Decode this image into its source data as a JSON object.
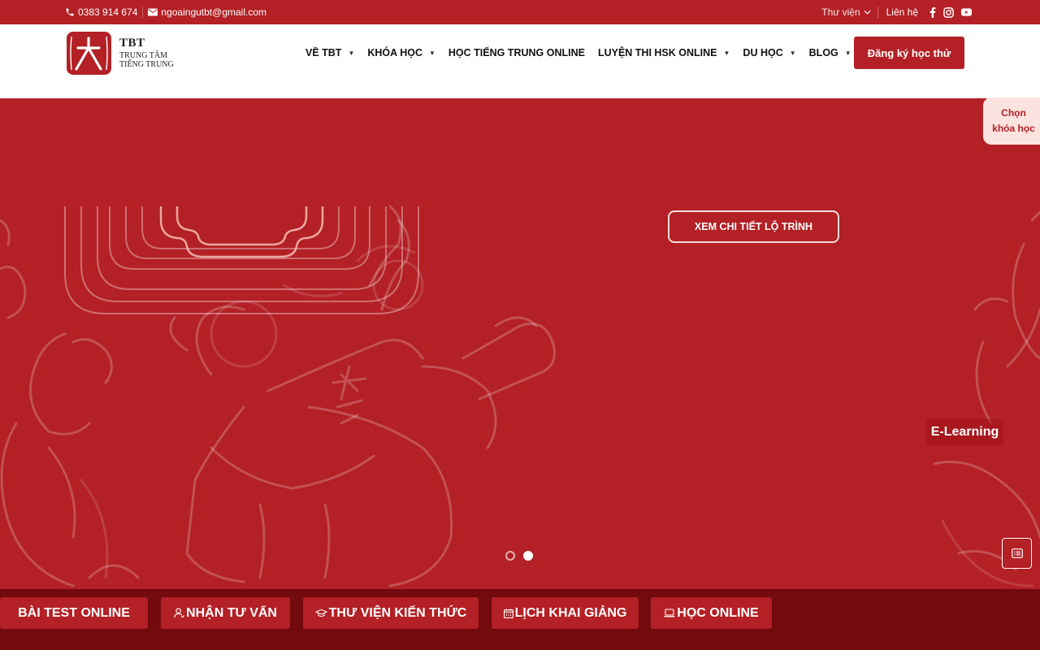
{
  "topbar": {
    "phone": "0383 914 674",
    "email": "ngoaingutbt@gmail.com",
    "library_label": "Thư viện",
    "contact_label": "Liên hệ",
    "social": [
      "facebook-icon",
      "instagram-icon",
      "youtube-icon"
    ]
  },
  "header": {
    "logo": {
      "line1": "TBT",
      "line2": "TRUNG TÂM",
      "line3": "TIẾNG TRUNG"
    },
    "nav": [
      {
        "label": "VỀ TBT",
        "dropdown": true
      },
      {
        "label": "KHÓA HỌC",
        "dropdown": true
      },
      {
        "label": "HỌC TIẾNG TRUNG ONLINE",
        "dropdown": false
      },
      {
        "label": "LUYỆN THI HSK ONLINE",
        "dropdown": true
      },
      {
        "label": "DU HỌC",
        "dropdown": true
      },
      {
        "label": "BLOG",
        "dropdown": true
      }
    ],
    "cta_label": "Đăng ký học thử"
  },
  "hero": {
    "detail_button": "XEM CHI TIẾT LỘ TRÌNH",
    "elearning_label": "E-Learning",
    "slides": 2,
    "active_slide": 2
  },
  "side_tab": {
    "line1": "Chọn",
    "line2": "khóa học"
  },
  "bottom_bar": [
    {
      "label": "BÀI TEST ONLINE",
      "icon": ""
    },
    {
      "label": "NHẬN TƯ VẤN",
      "icon": "user-icon"
    },
    {
      "label": "THƯ VIỆN KIẾN THỨC",
      "icon": "graduation-cap-icon"
    },
    {
      "label": "LỊCH KHAI GIẢNG",
      "icon": "calendar-icon"
    },
    {
      "label": "HỌC ONLINE",
      "icon": "laptop-icon"
    }
  ],
  "colors": {
    "brand": "#b32025",
    "dark": "#720a0e",
    "tab_bg": "#fbe3df"
  }
}
